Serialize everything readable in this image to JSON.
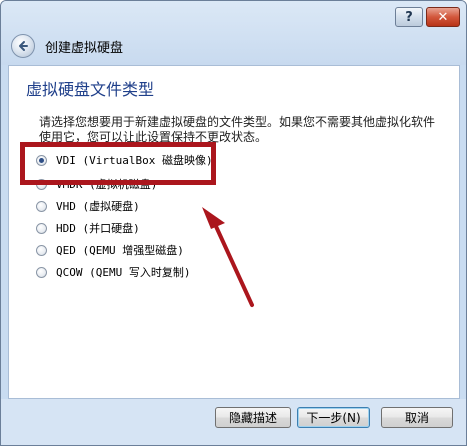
{
  "window": {
    "help_label": "?",
    "close_label": "✕"
  },
  "wizard": {
    "title": "创建虚拟硬盘",
    "heading": "虚拟硬盘文件类型",
    "description": "请选择您想要用于新建虚拟硬盘的文件类型。如果您不需要其他虚拟化软件使用它，您可以让此设置保持不更改状态。"
  },
  "options": [
    {
      "label": "VDI (VirtualBox 磁盘映像)",
      "checked": true
    },
    {
      "label": "VMDK (虚拟机磁盘)",
      "checked": false
    },
    {
      "label": "VHD (虚拟硬盘)",
      "checked": false
    },
    {
      "label": "HDD (并口硬盘)",
      "checked": false
    },
    {
      "label": "QED (QEMU 增强型磁盘)",
      "checked": false
    },
    {
      "label": "QCOW (QEMU 写入时复制)",
      "checked": false
    }
  ],
  "buttons": {
    "hide_description": "隐藏描述",
    "next": "下一步(N)",
    "cancel": "取消"
  },
  "colors": {
    "annotation": "#ab161d",
    "heading": "#1f3f8a"
  }
}
